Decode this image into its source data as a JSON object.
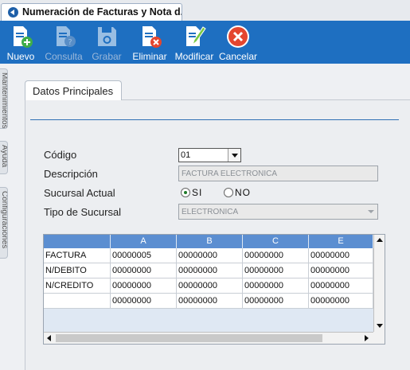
{
  "window": {
    "title": "Numeración de Facturas y Nota d..."
  },
  "toolbar": {
    "buttons": [
      {
        "id": "nuevo",
        "label": "Nuevo",
        "icon": "document-add-icon",
        "enabled": true
      },
      {
        "id": "consulta",
        "label": "Consulta",
        "icon": "document-query-icon",
        "enabled": false
      },
      {
        "id": "grabar",
        "label": "Grabar",
        "icon": "save-disk-icon",
        "enabled": false
      },
      {
        "id": "eliminar",
        "label": "Eliminar",
        "icon": "document-delete-icon",
        "enabled": true
      },
      {
        "id": "modificar",
        "label": "Modificar",
        "icon": "document-edit-icon",
        "enabled": true
      },
      {
        "id": "cancelar",
        "label": "Cancelar",
        "icon": "cancel-x-icon",
        "enabled": true
      }
    ]
  },
  "side_tabs": [
    "Mantenimientos",
    "Ayuda",
    "Configuraciones"
  ],
  "tab": {
    "label": "Datos Principales"
  },
  "form": {
    "codigo_label": "Código",
    "codigo_value": "01",
    "descripcion_label": "Descripción",
    "descripcion_value": "FACTURA ELECTRONICA",
    "sucursal_label": "Sucursal Actual",
    "sucursal_options": [
      "SI",
      "NO"
    ],
    "sucursal_selected": "SI",
    "tipo_label": "Tipo de Sucursal",
    "tipo_value": "ELECTRONICA"
  },
  "grid": {
    "columns": [
      "",
      "A",
      "B",
      "C",
      "E"
    ],
    "rows": [
      [
        "FACTURA",
        "00000005",
        "00000000",
        "00000000",
        "00000000"
      ],
      [
        "N/DEBITO",
        "00000000",
        "00000000",
        "00000000",
        "00000000"
      ],
      [
        "N/CREDITO",
        "00000000",
        "00000000",
        "00000000",
        "00000000"
      ],
      [
        "",
        "00000000",
        "00000000",
        "00000000",
        "00000000"
      ]
    ]
  },
  "colors": {
    "toolbar": "#1e6fc1",
    "grid_header": "#5b8ed1",
    "accent_line": "#2f6fb4"
  }
}
